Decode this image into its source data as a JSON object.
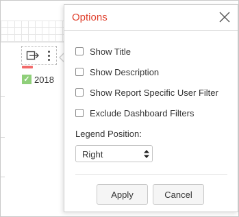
{
  "background": {
    "legend_item": {
      "label": "2018",
      "checkmark": "✓"
    }
  },
  "popup": {
    "title": "Options",
    "options": [
      {
        "label": "Show Title",
        "checked": false
      },
      {
        "label": "Show Description",
        "checked": false
      },
      {
        "label": "Show Report Specific User Filter",
        "checked": false
      },
      {
        "label": "Exclude Dashboard Filters",
        "checked": false
      }
    ],
    "legend_position": {
      "label": "Legend Position:",
      "selected": "Right"
    },
    "buttons": {
      "apply": "Apply",
      "cancel": "Cancel"
    }
  },
  "colors": {
    "title_red": "#e0412e",
    "legend_bar_red": "#f26b6b",
    "legend_check_green": "#8fcf7a"
  },
  "icons": [
    "export-icon",
    "more-vertical-icon",
    "close-icon",
    "checkbox-icon",
    "select-arrows-icon"
  ]
}
